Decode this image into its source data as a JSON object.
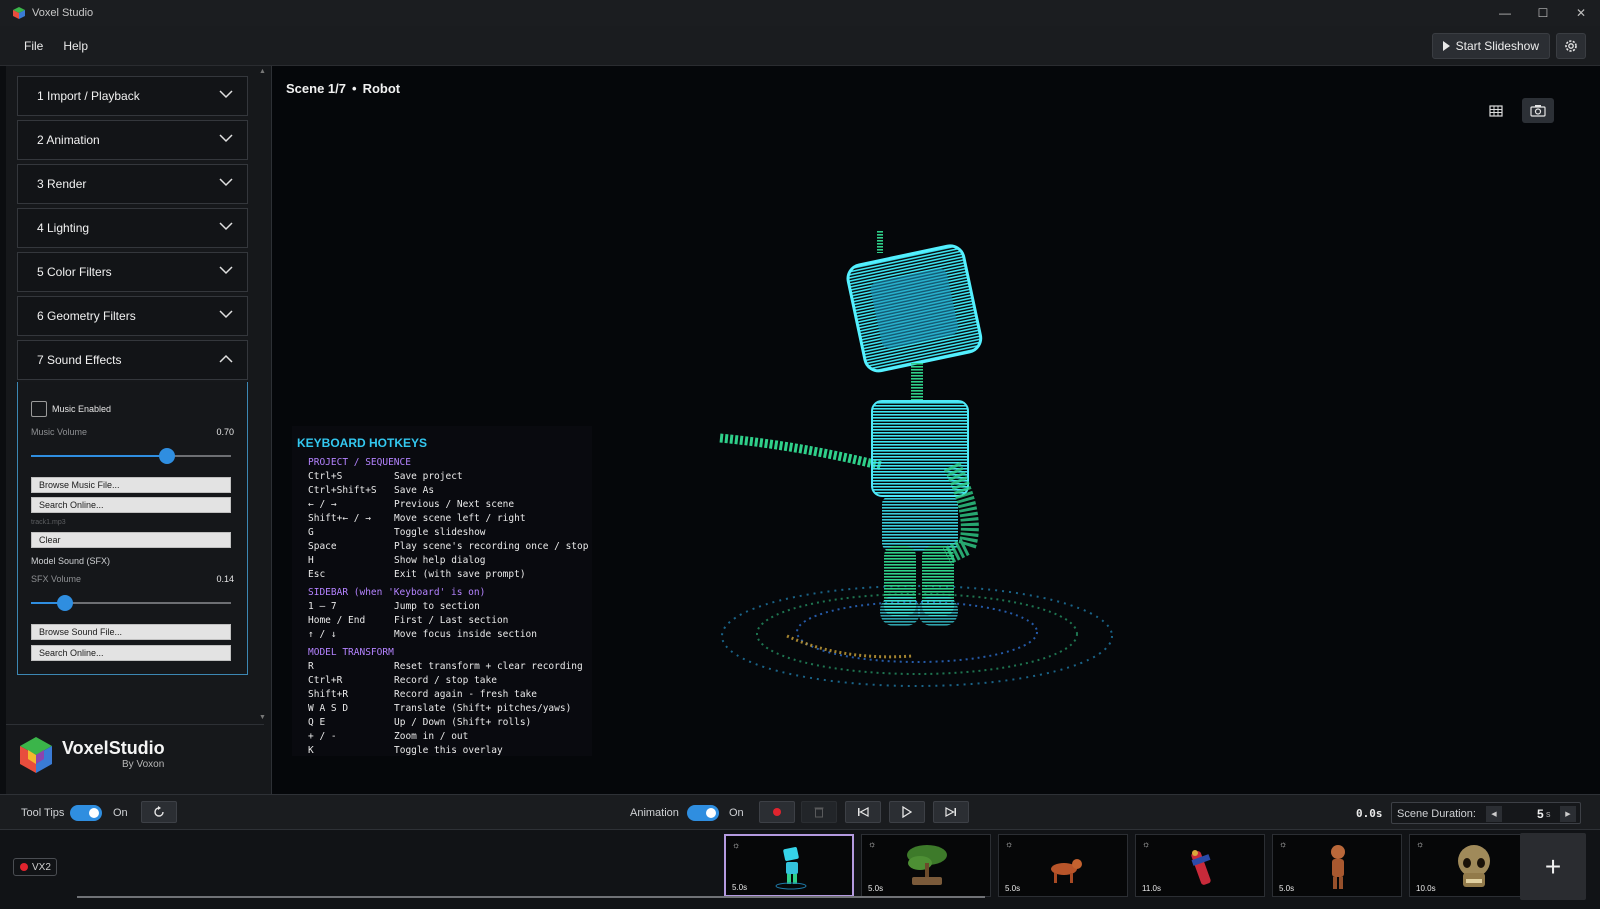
{
  "window": {
    "title": "Voxel Studio",
    "controls": [
      "—",
      "☐",
      "✕"
    ]
  },
  "menu": {
    "file": "File",
    "help": "Help",
    "start_slideshow": "Start Slideshow"
  },
  "sidebar": {
    "sections": [
      {
        "label": "1  Import / Playback",
        "expanded": false
      },
      {
        "label": "2  Animation",
        "expanded": false
      },
      {
        "label": "3  Render",
        "expanded": false
      },
      {
        "label": "4  Lighting",
        "expanded": false
      },
      {
        "label": "5  Color Filters",
        "expanded": false
      },
      {
        "label": "6  Geometry Filters",
        "expanded": false
      },
      {
        "label": "7  Sound Effects",
        "expanded": true
      }
    ],
    "sound": {
      "music_enabled_label": "Music Enabled",
      "music_enabled": false,
      "music_volume_label": "Music Volume",
      "music_volume": "0.70",
      "browse_music": "Browse Music File...",
      "search_online_1": "Search Online...",
      "music_file": "track1.mp3",
      "clear": "Clear",
      "model_sound_label": "Model Sound (SFX)",
      "sfx_volume_label": "SFX Volume",
      "sfx_volume": "0.14",
      "browse_sound": "Browse Sound File...",
      "search_online_2": "Search Online..."
    },
    "brand": {
      "name": "VoxelStudio",
      "sub": "By Voxon"
    }
  },
  "viewport": {
    "scene_index": "Scene 1/7",
    "separator": "•",
    "scene_name": "Robot",
    "hotkeys": {
      "title": "KEYBOARD HOTKEYS",
      "groups": [
        {
          "heading": "PROJECT / SEQUENCE",
          "rows": [
            {
              "key": "Ctrl+S",
              "desc": "Save project"
            },
            {
              "key": "Ctrl+Shift+S",
              "desc": "Save As"
            },
            {
              "key": "← / →",
              "desc": "Previous / Next scene"
            },
            {
              "key": "Shift+← / →",
              "desc": "Move scene left / right"
            },
            {
              "key": "G",
              "desc": "Toggle slideshow"
            },
            {
              "key": "Space",
              "desc": "Play scene's recording once / stop"
            },
            {
              "key": "H",
              "desc": "Show help dialog"
            },
            {
              "key": "Esc",
              "desc": "Exit (with save prompt)"
            }
          ]
        },
        {
          "heading": "SIDEBAR (when 'Keyboard' is on)",
          "rows": [
            {
              "key": "1 – 7",
              "desc": "Jump to section"
            },
            {
              "key": "Home / End",
              "desc": "First / Last section"
            },
            {
              "key": "↑ / ↓",
              "desc": "Move focus inside section"
            }
          ]
        },
        {
          "heading": "MODEL TRANSFORM",
          "rows": [
            {
              "key": "R",
              "desc": "Reset transform + clear recording"
            },
            {
              "key": "Ctrl+R",
              "desc": "Record / stop take"
            },
            {
              "key": "Shift+R",
              "desc": "Record again - fresh take"
            },
            {
              "key": "W A S D",
              "desc": "Translate (Shift+ pitches/yaws)"
            },
            {
              "key": "Q E",
              "desc": "Up / Down (Shift+ rolls)"
            },
            {
              "key": "+ / -",
              "desc": "Zoom in / out"
            },
            {
              "key": "K",
              "desc": "Toggle this overlay"
            }
          ]
        }
      ]
    }
  },
  "controlbar": {
    "tooltips_label": "Tool Tips",
    "tooltips_state": "On",
    "animation_label": "Animation",
    "animation_state": "On",
    "time": "0.0s",
    "scene_duration_label": "Scene Duration:",
    "scene_duration_value": "5",
    "scene_duration_unit": "s"
  },
  "timeline": {
    "device": "VX2",
    "scenes": [
      {
        "name": "Robot",
        "duration": "5.0s",
        "selected": true
      },
      {
        "name": "Bonsai",
        "duration": "5.0s",
        "selected": false
      },
      {
        "name": "Dog",
        "duration": "5.0s",
        "selected": false
      },
      {
        "name": "Figure",
        "duration": "11.0s",
        "selected": false
      },
      {
        "name": "Groot",
        "duration": "5.0s",
        "selected": false
      },
      {
        "name": "Skull",
        "duration": "10.0s",
        "selected": false
      }
    ],
    "add_label": "+"
  },
  "colors": {
    "accent": "#2f8ee0",
    "hotkey_title": "#33c8f0",
    "hotkey_heading": "#b483ff",
    "selected_border": "#b49ae0",
    "record": "#e0242e"
  }
}
